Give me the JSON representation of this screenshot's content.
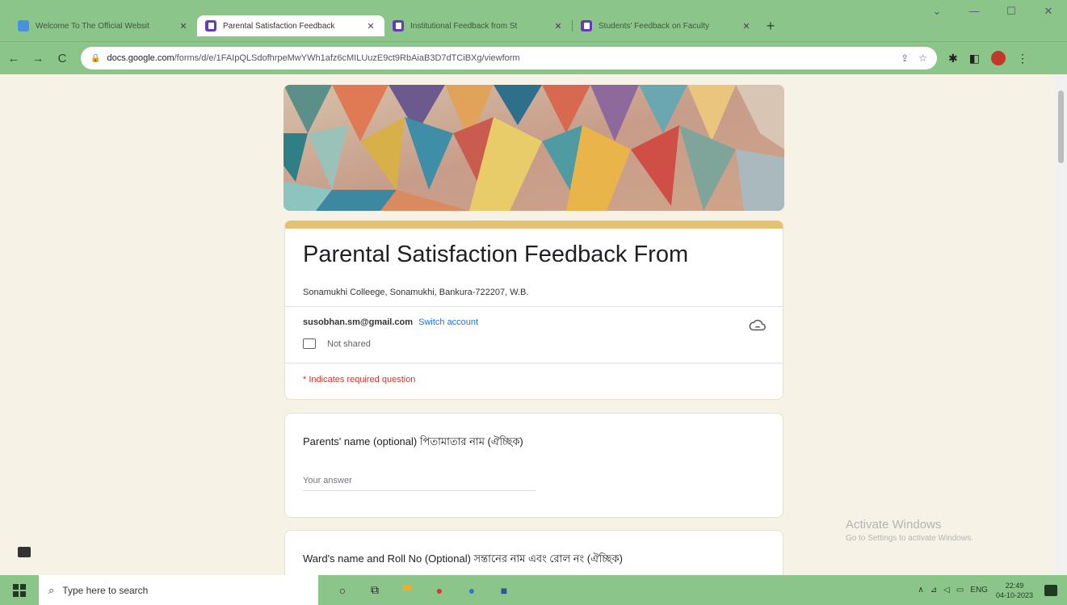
{
  "browser": {
    "tabs": [
      {
        "label": "Welcome To The Official Websit",
        "active": false
      },
      {
        "label": "Parental Satisfaction Feedback",
        "active": true
      },
      {
        "label": "Institutional Feedback from St",
        "active": false
      },
      {
        "label": "Students' Feedback on Faculty",
        "active": false
      }
    ],
    "url_host": "docs.google.com",
    "url_path": "/forms/d/e/1FAIpQLSdofhrpeMwYWh1afz6cMILUuzE9ct9RbAiaB3D7dTCiBXg/viewform"
  },
  "form": {
    "title": "Parental Satisfaction Feedback From",
    "subtitle": "Sonamukhi Colleege, Sonamukhi, Bankura-722207, W.B.",
    "account_email": "susobhan.sm@gmail.com",
    "switch_account_label": "Switch account",
    "not_shared_label": "Not shared",
    "required_note": "* Indicates required question",
    "questions": [
      {
        "label": "Parents' name (optional) পিতামাতার নাম (ঐচ্ছিক)",
        "placeholder": "Your answer"
      },
      {
        "label": "Ward's name and Roll No (Optional) সন্তানের নাম এবং রোল নং (ঐচ্ছিক)"
      }
    ]
  },
  "watermark": {
    "line1": "Activate Windows",
    "line2": "Go to Settings to activate Windows."
  },
  "taskbar": {
    "search_placeholder": "Type here to search",
    "language": "ENG",
    "time": "22:49",
    "date": "04-10-2023"
  },
  "colors": {
    "theme_green": "#8bc58a",
    "form_accent": "#e3c273",
    "page_bg": "#f6f3e6",
    "required_red": "#d93025",
    "link_blue": "#1a73e8"
  }
}
